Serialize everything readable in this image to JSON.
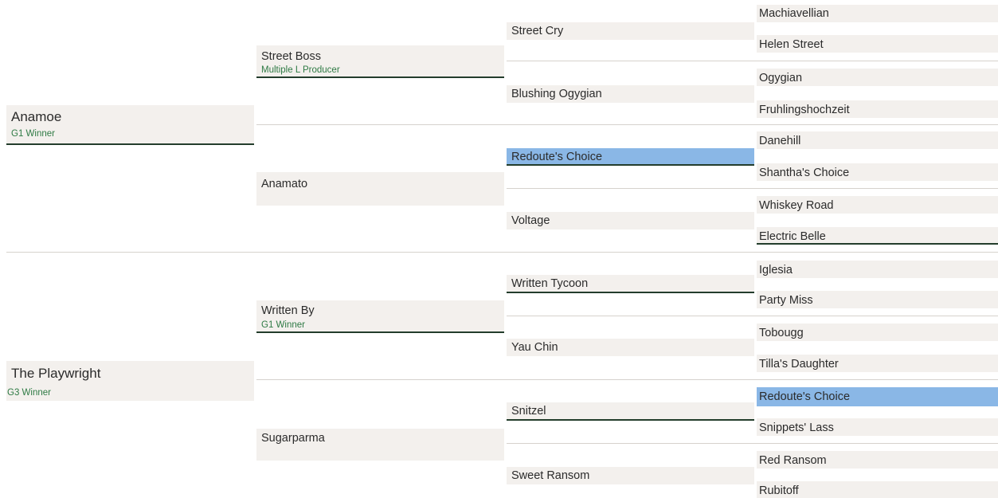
{
  "pedigree": {
    "parents": [
      {
        "name": "Anamoe",
        "badge": "G1 Winner"
      },
      {
        "name": "The Playwright",
        "badge": "G3 Winner"
      }
    ],
    "grandparents": [
      {
        "name": "Street Boss",
        "badge": "Multiple L Producer"
      },
      {
        "name": "Anamato",
        "badge": ""
      },
      {
        "name": "Written By",
        "badge": "G1 Winner"
      },
      {
        "name": "Sugarparma",
        "badge": ""
      }
    ],
    "great_grandparents": [
      {
        "name": "Street Cry"
      },
      {
        "name": "Blushing Ogygian"
      },
      {
        "name": "Redoute's Choice",
        "highlighted": true
      },
      {
        "name": "Voltage"
      },
      {
        "name": "Written Tycoon"
      },
      {
        "name": "Yau Chin"
      },
      {
        "name": "Snitzel"
      },
      {
        "name": "Sweet Ransom"
      }
    ],
    "great_great_grandparents": [
      {
        "name": "Machiavellian"
      },
      {
        "name": "Helen Street"
      },
      {
        "name": "Ogygian"
      },
      {
        "name": "Fruhlingshochzeit"
      },
      {
        "name": "Danehill"
      },
      {
        "name": "Shantha's Choice"
      },
      {
        "name": "Whiskey Road"
      },
      {
        "name": "Electric Belle"
      },
      {
        "name": "Iglesia"
      },
      {
        "name": "Party Miss"
      },
      {
        "name": "Tobougg"
      },
      {
        "name": "Tilla's Daughter"
      },
      {
        "name": "Redoute's Choice",
        "highlighted": true
      },
      {
        "name": "Snippets' Lass"
      },
      {
        "name": "Red Ransom"
      },
      {
        "name": "Rubitoff"
      }
    ]
  },
  "colors": {
    "box_bg": "#f3f0ed",
    "highlight": "#8ab7e6",
    "badge_text": "#2e7a44",
    "underline": "#233d2c"
  }
}
